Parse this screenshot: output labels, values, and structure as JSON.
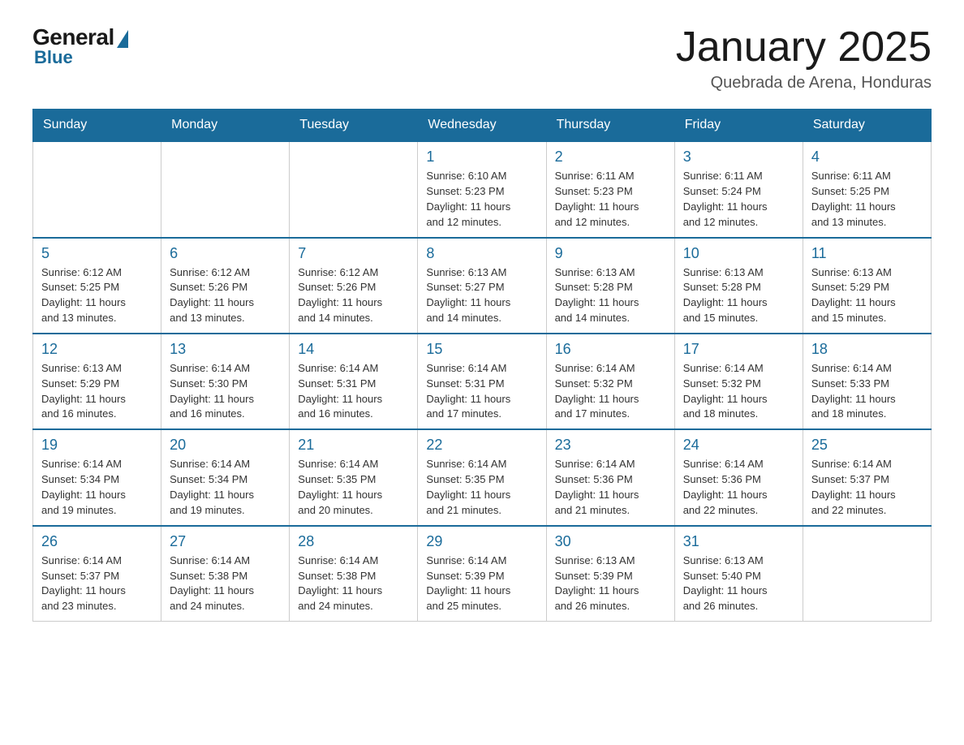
{
  "logo": {
    "general": "General",
    "blue": "Blue"
  },
  "header": {
    "title": "January 2025",
    "location": "Quebrada de Arena, Honduras"
  },
  "days_of_week": [
    "Sunday",
    "Monday",
    "Tuesday",
    "Wednesday",
    "Thursday",
    "Friday",
    "Saturday"
  ],
  "weeks": [
    [
      {
        "day": "",
        "info": ""
      },
      {
        "day": "",
        "info": ""
      },
      {
        "day": "",
        "info": ""
      },
      {
        "day": "1",
        "info": "Sunrise: 6:10 AM\nSunset: 5:23 PM\nDaylight: 11 hours\nand 12 minutes."
      },
      {
        "day": "2",
        "info": "Sunrise: 6:11 AM\nSunset: 5:23 PM\nDaylight: 11 hours\nand 12 minutes."
      },
      {
        "day": "3",
        "info": "Sunrise: 6:11 AM\nSunset: 5:24 PM\nDaylight: 11 hours\nand 12 minutes."
      },
      {
        "day": "4",
        "info": "Sunrise: 6:11 AM\nSunset: 5:25 PM\nDaylight: 11 hours\nand 13 minutes."
      }
    ],
    [
      {
        "day": "5",
        "info": "Sunrise: 6:12 AM\nSunset: 5:25 PM\nDaylight: 11 hours\nand 13 minutes."
      },
      {
        "day": "6",
        "info": "Sunrise: 6:12 AM\nSunset: 5:26 PM\nDaylight: 11 hours\nand 13 minutes."
      },
      {
        "day": "7",
        "info": "Sunrise: 6:12 AM\nSunset: 5:26 PM\nDaylight: 11 hours\nand 14 minutes."
      },
      {
        "day": "8",
        "info": "Sunrise: 6:13 AM\nSunset: 5:27 PM\nDaylight: 11 hours\nand 14 minutes."
      },
      {
        "day": "9",
        "info": "Sunrise: 6:13 AM\nSunset: 5:28 PM\nDaylight: 11 hours\nand 14 minutes."
      },
      {
        "day": "10",
        "info": "Sunrise: 6:13 AM\nSunset: 5:28 PM\nDaylight: 11 hours\nand 15 minutes."
      },
      {
        "day": "11",
        "info": "Sunrise: 6:13 AM\nSunset: 5:29 PM\nDaylight: 11 hours\nand 15 minutes."
      }
    ],
    [
      {
        "day": "12",
        "info": "Sunrise: 6:13 AM\nSunset: 5:29 PM\nDaylight: 11 hours\nand 16 minutes."
      },
      {
        "day": "13",
        "info": "Sunrise: 6:14 AM\nSunset: 5:30 PM\nDaylight: 11 hours\nand 16 minutes."
      },
      {
        "day": "14",
        "info": "Sunrise: 6:14 AM\nSunset: 5:31 PM\nDaylight: 11 hours\nand 16 minutes."
      },
      {
        "day": "15",
        "info": "Sunrise: 6:14 AM\nSunset: 5:31 PM\nDaylight: 11 hours\nand 17 minutes."
      },
      {
        "day": "16",
        "info": "Sunrise: 6:14 AM\nSunset: 5:32 PM\nDaylight: 11 hours\nand 17 minutes."
      },
      {
        "day": "17",
        "info": "Sunrise: 6:14 AM\nSunset: 5:32 PM\nDaylight: 11 hours\nand 18 minutes."
      },
      {
        "day": "18",
        "info": "Sunrise: 6:14 AM\nSunset: 5:33 PM\nDaylight: 11 hours\nand 18 minutes."
      }
    ],
    [
      {
        "day": "19",
        "info": "Sunrise: 6:14 AM\nSunset: 5:34 PM\nDaylight: 11 hours\nand 19 minutes."
      },
      {
        "day": "20",
        "info": "Sunrise: 6:14 AM\nSunset: 5:34 PM\nDaylight: 11 hours\nand 19 minutes."
      },
      {
        "day": "21",
        "info": "Sunrise: 6:14 AM\nSunset: 5:35 PM\nDaylight: 11 hours\nand 20 minutes."
      },
      {
        "day": "22",
        "info": "Sunrise: 6:14 AM\nSunset: 5:35 PM\nDaylight: 11 hours\nand 21 minutes."
      },
      {
        "day": "23",
        "info": "Sunrise: 6:14 AM\nSunset: 5:36 PM\nDaylight: 11 hours\nand 21 minutes."
      },
      {
        "day": "24",
        "info": "Sunrise: 6:14 AM\nSunset: 5:36 PM\nDaylight: 11 hours\nand 22 minutes."
      },
      {
        "day": "25",
        "info": "Sunrise: 6:14 AM\nSunset: 5:37 PM\nDaylight: 11 hours\nand 22 minutes."
      }
    ],
    [
      {
        "day": "26",
        "info": "Sunrise: 6:14 AM\nSunset: 5:37 PM\nDaylight: 11 hours\nand 23 minutes."
      },
      {
        "day": "27",
        "info": "Sunrise: 6:14 AM\nSunset: 5:38 PM\nDaylight: 11 hours\nand 24 minutes."
      },
      {
        "day": "28",
        "info": "Sunrise: 6:14 AM\nSunset: 5:38 PM\nDaylight: 11 hours\nand 24 minutes."
      },
      {
        "day": "29",
        "info": "Sunrise: 6:14 AM\nSunset: 5:39 PM\nDaylight: 11 hours\nand 25 minutes."
      },
      {
        "day": "30",
        "info": "Sunrise: 6:13 AM\nSunset: 5:39 PM\nDaylight: 11 hours\nand 26 minutes."
      },
      {
        "day": "31",
        "info": "Sunrise: 6:13 AM\nSunset: 5:40 PM\nDaylight: 11 hours\nand 26 minutes."
      },
      {
        "day": "",
        "info": ""
      }
    ]
  ]
}
